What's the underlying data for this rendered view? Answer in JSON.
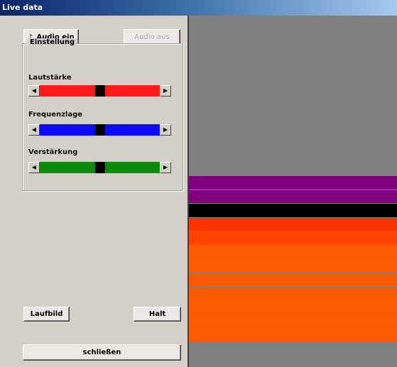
{
  "window": {
    "title": "Live data"
  },
  "buttons": {
    "audio_on": "Audio ein",
    "audio_off": "Audio aus",
    "live": "Laufbild",
    "stop": "Halt",
    "close": "schließen"
  },
  "group": {
    "title": "Einstellung",
    "sliders": [
      {
        "label": "Lautstärke",
        "color": "#ff1a1a",
        "value": 0.5
      },
      {
        "label": "Frequenzlage",
        "color": "#0a0aff",
        "value": 0.5
      },
      {
        "label": "Verstärkung",
        "color": "#0c8a0c",
        "value": 0.5
      }
    ]
  },
  "display": {
    "background": "#808080",
    "bands": [
      {
        "color": "#800080"
      },
      {
        "color": "#800080"
      },
      {
        "color": "#000000"
      },
      {
        "color": "#ff3300"
      },
      {
        "color": "#ff4500"
      },
      {
        "color": "#ff5a00"
      },
      {
        "color": "#ff5a00"
      },
      {
        "color": "#ff5a00"
      },
      {
        "color": "#ff5a00"
      },
      {
        "color": "#ff5a00"
      },
      {
        "color": "#ff5a00"
      },
      {
        "color": "#ff5a00"
      }
    ]
  }
}
